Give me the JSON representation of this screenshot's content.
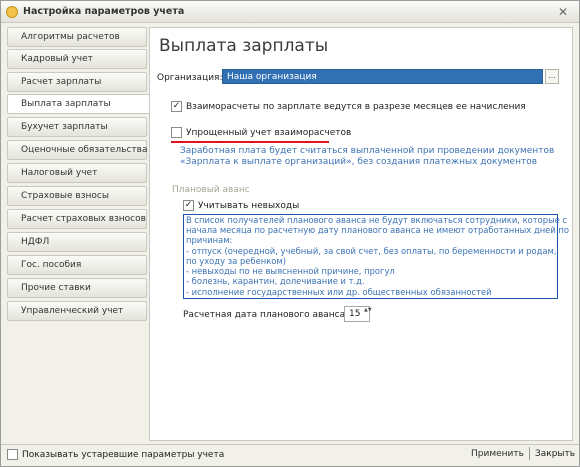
{
  "window": {
    "title": "Настройка параметров учета",
    "close_glyph": "✕"
  },
  "sidebar": {
    "items": [
      {
        "label": "Алгоритмы расчетов"
      },
      {
        "label": "Кадровый учет"
      },
      {
        "label": "Расчет зарплаты"
      },
      {
        "label": "Выплата зарплаты",
        "active": true
      },
      {
        "label": "Бухучет зарплаты"
      },
      {
        "label": "Оценочные обязательства"
      },
      {
        "label": "Налоговый учет"
      },
      {
        "label": "Страховые взносы"
      },
      {
        "label": "Расчет страховых взносов"
      },
      {
        "label": "НДФЛ"
      },
      {
        "label": "Гос. пособия"
      },
      {
        "label": "Прочие ставки"
      },
      {
        "label": "Управленческий учет"
      }
    ]
  },
  "main": {
    "title": "Выплата зарплаты",
    "org_label": "Организация:",
    "org_value": "Наша организация",
    "org_select_glyph": "...",
    "mutual_settlements": {
      "label": "Взаиморасчеты по зарплате ведутся в разрезе месяцев ее начисления",
      "checked": true
    },
    "simplified": {
      "label": "Упрощенный учет взаиморасчетов",
      "checked": false
    },
    "simplified_hint_1": "Заработная плата будет считаться выплаченной при проведении документов",
    "simplified_hint_2": "«Зарплата к выплате организаций», без создания платежных документов",
    "advance_section": "Плановый аванс",
    "absences": {
      "label": "Учитывать невыходы",
      "checked": true
    },
    "absences_hint": [
      "В список получателей планового аванса не будут включаться сотрудники, которые с",
      "начала месяца по расчетную дату планового аванса не имеют отработанных дней по",
      "причинам:",
      "- отпуск (очередной, учебный, за свой счет, без оплаты, по беременности и родам,",
      "по уходу за ребенком)",
      "- невыходы по не выясненной причине, прогул",
      "- болезнь, карантин, долечивание и т.д.",
      "- исполнение государственных или др. общественных обязанностей"
    ],
    "advance_date_label": "Расчетная дата планового аванса:",
    "advance_date_value": "15",
    "spin_glyph": "▲▼"
  },
  "footer": {
    "show_obsolete": {
      "label": "Показывать устаревшие параметры учета",
      "checked": false
    },
    "apply_label": "Применить",
    "close_label": "Закрыть"
  },
  "colors": {
    "accent": "#3270b4",
    "hint_text": "#3c73b6",
    "highlight_line": "#e0121c",
    "box_border": "#1a54ab"
  }
}
